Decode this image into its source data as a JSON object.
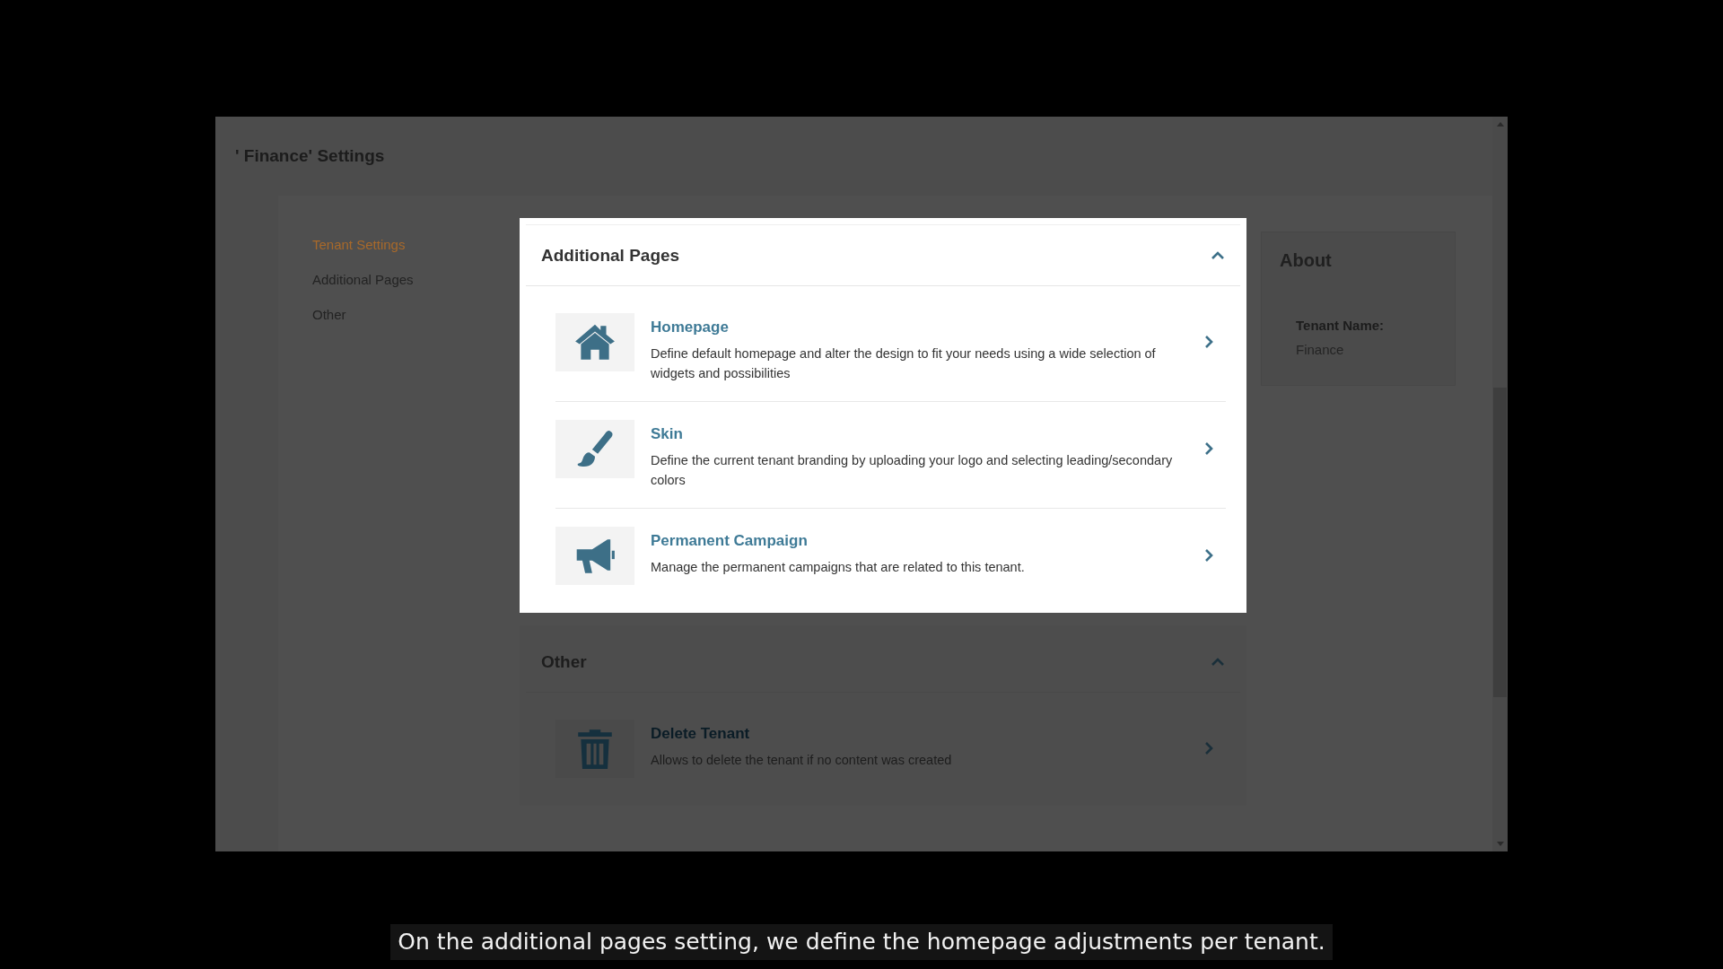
{
  "page_title": "' Finance' Settings",
  "sidebar": {
    "items": [
      {
        "label": "Tenant Settings",
        "selected": true
      },
      {
        "label": "Additional Pages",
        "selected": false
      },
      {
        "label": "Other",
        "selected": false
      }
    ]
  },
  "sections": [
    {
      "title": "Additional Pages",
      "expanded": true,
      "spotlight": true,
      "items": [
        {
          "kind": "home",
          "title": "Homepage",
          "description": "Define default homepage and alter the design to fit your needs using a wide selection of widgets and possibilities"
        },
        {
          "kind": "brush",
          "title": "Skin",
          "description": "Define the current tenant branding by uploading your logo and selecting leading/secondary colors"
        },
        {
          "kind": "megaphone",
          "title": "Permanent Campaign",
          "description": "Manage the permanent campaigns that are related to this tenant."
        }
      ]
    },
    {
      "title": "Other",
      "expanded": true,
      "spotlight": false,
      "items": [
        {
          "kind": "trash",
          "title": "Delete Tenant",
          "description": "Allows to delete the tenant if no content was created"
        }
      ]
    }
  ],
  "about": {
    "title": "About",
    "fields": [
      {
        "label": "Tenant Name:",
        "value": "Finance"
      }
    ]
  },
  "caption": "On the additional pages setting, we define the homepage adjustments per tenant."
}
